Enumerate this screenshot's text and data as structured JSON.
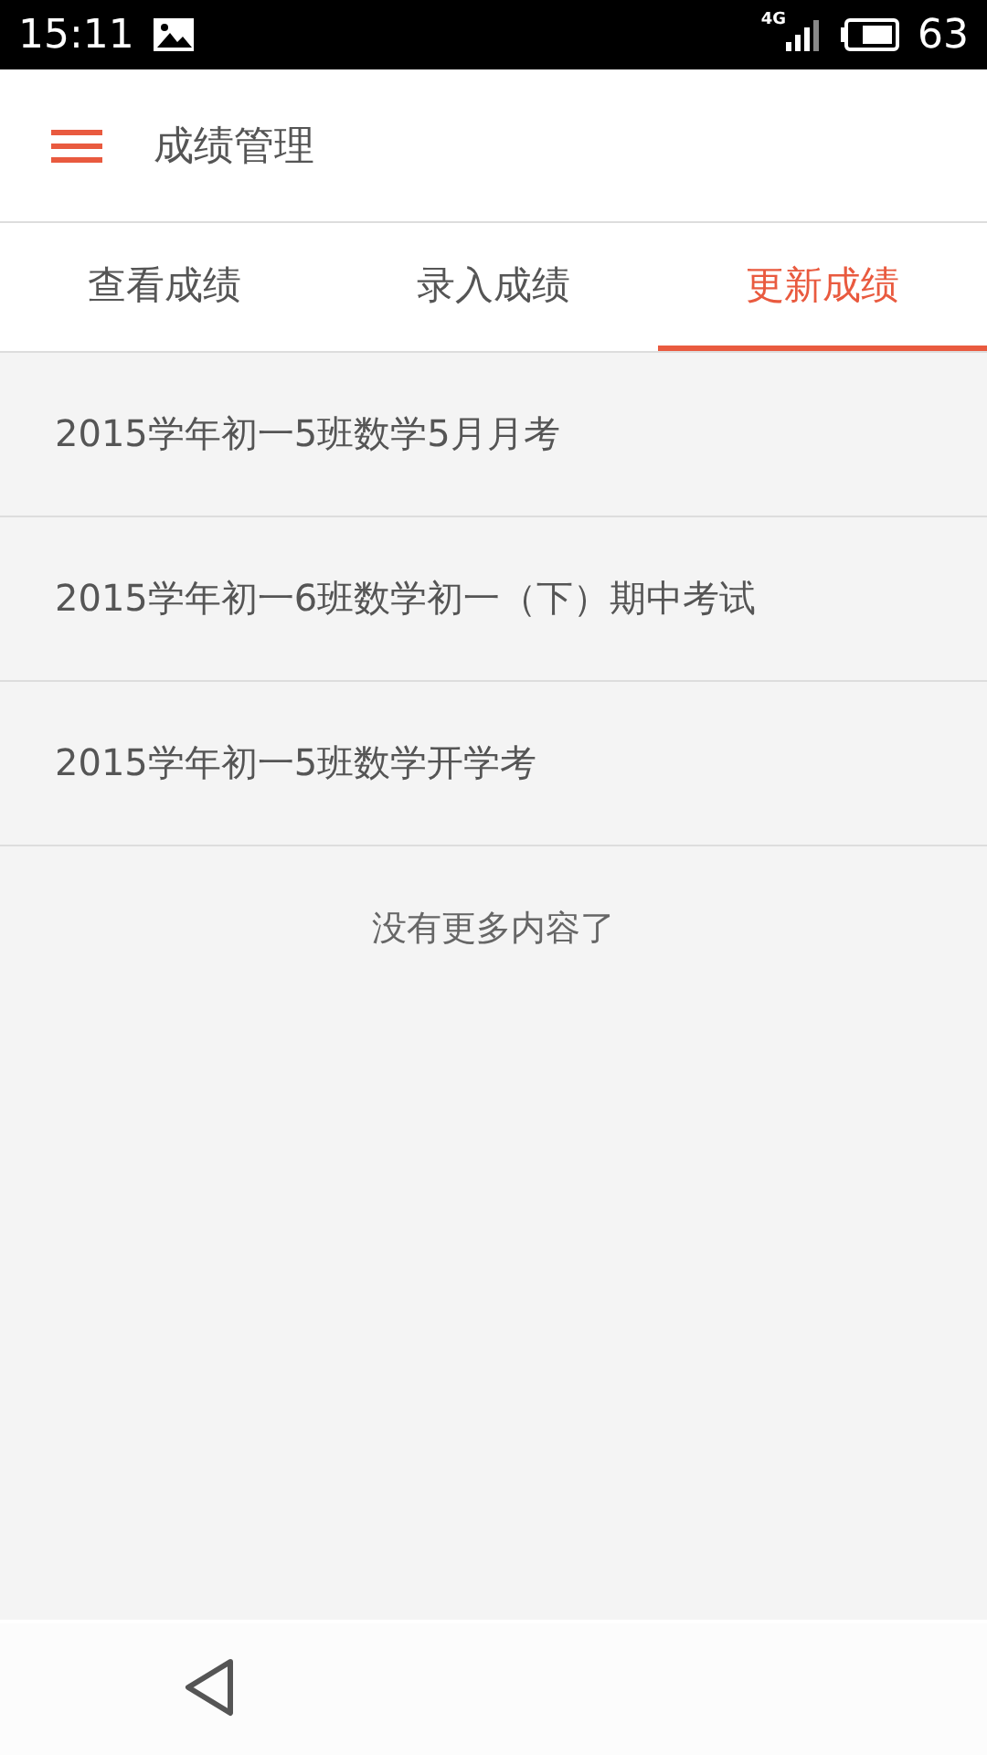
{
  "status_bar": {
    "time": "15:11",
    "network": "4G",
    "battery": "63"
  },
  "app_bar": {
    "title": "成绩管理"
  },
  "tabs": [
    {
      "label": "查看成绩",
      "selected": false
    },
    {
      "label": "录入成绩",
      "selected": false
    },
    {
      "label": "更新成绩",
      "selected": true
    }
  ],
  "exams": [
    {
      "title": "2015学年初一5班数学5月月考"
    },
    {
      "title": "2015学年初一6班数学初一（下）期中考试"
    },
    {
      "title": "2015学年初一5班数学开学考"
    }
  ],
  "end_message": "没有更多内容了"
}
